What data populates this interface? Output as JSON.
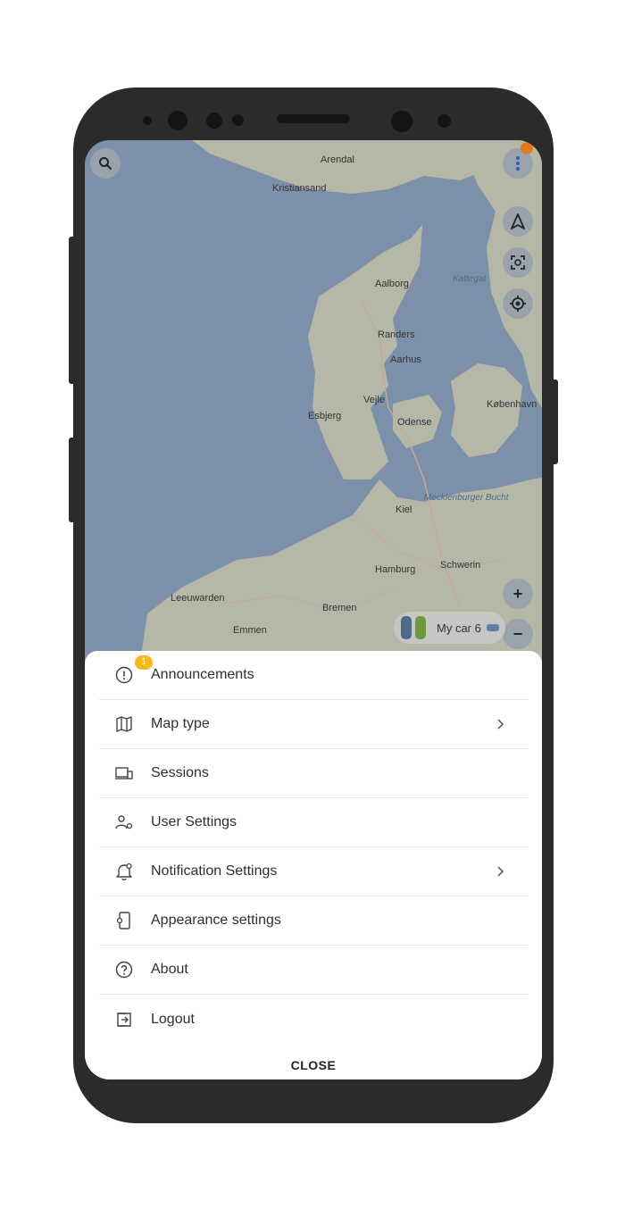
{
  "map": {
    "labels": {
      "arendal": "Arendal",
      "kristiansand": "Kristiansand",
      "aalborg": "Aalborg",
      "kattegat": "Kattegat",
      "randers": "Randers",
      "aarhus": "Aarhus",
      "vejle": "Vejle",
      "esbjerg": "Esbjerg",
      "odense": "Odense",
      "kobenhavn": "København",
      "mecklenburger": "Mecklenburger Bucht",
      "kiel": "Kiel",
      "hamburg": "Hamburg",
      "schwerin": "Schwerin",
      "leeuwarden": "Leeuwarden",
      "bremen": "Bremen",
      "emmen": "Emmen"
    },
    "controls": {
      "zoom_in": "+",
      "zoom_out": "−"
    },
    "car_chip": {
      "label": "My car 6"
    }
  },
  "menu": {
    "items": [
      {
        "label": "Announcements",
        "icon": "info-circle-icon",
        "badge": "1"
      },
      {
        "label": "Map type",
        "icon": "map-icon",
        "chevron": true
      },
      {
        "label": "Sessions",
        "icon": "devices-icon"
      },
      {
        "label": "User Settings",
        "icon": "user-settings-icon"
      },
      {
        "label": "Notification Settings",
        "icon": "bell-settings-icon",
        "chevron": true
      },
      {
        "label": "Appearance settings",
        "icon": "appearance-icon"
      },
      {
        "label": "About",
        "icon": "help-circle-icon"
      },
      {
        "label": "Logout",
        "icon": "logout-icon"
      }
    ],
    "close_label": "CLOSE"
  },
  "colors": {
    "sea": "#7d90a9",
    "land": "#b6b8a7",
    "badge": "#f6b91a",
    "notification_dot": "#e07c1e"
  }
}
